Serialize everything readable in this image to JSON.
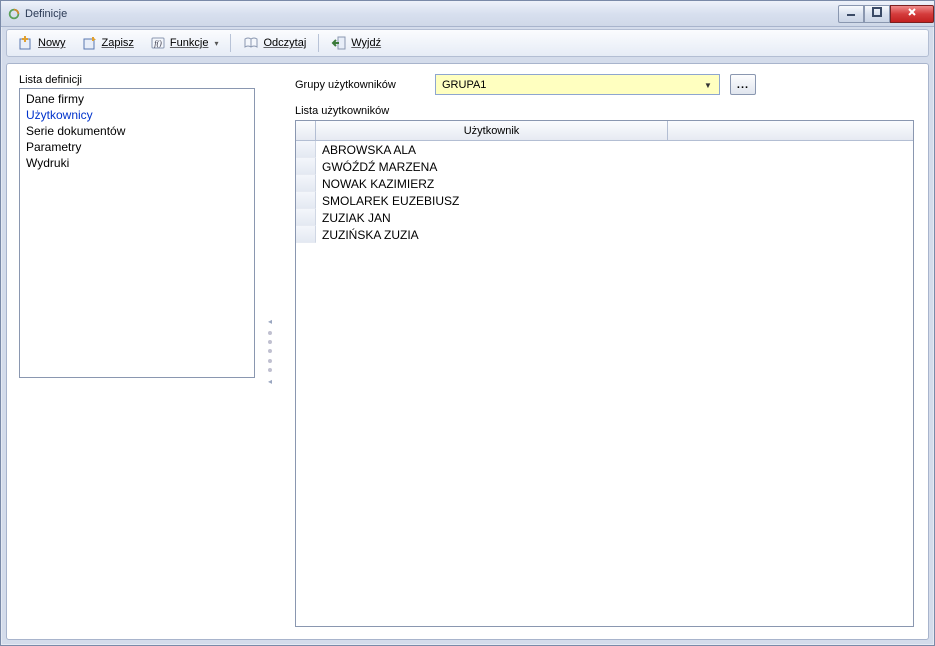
{
  "title": "Definicje",
  "toolbar": {
    "new": "Nowy",
    "save": "Zapisz",
    "functions": "Funkcje",
    "read": "Odczytaj",
    "exit": "Wyjdź"
  },
  "leftPane": {
    "label": "Lista definicji",
    "items": [
      {
        "name": "Dane firmy",
        "selected": false
      },
      {
        "name": "Użytkownicy",
        "selected": true
      },
      {
        "name": "Serie dokumentów",
        "selected": false
      },
      {
        "name": "Parametry",
        "selected": false
      },
      {
        "name": "Wydruki",
        "selected": false
      }
    ]
  },
  "rightPane": {
    "groupLabel": "Grupy użytkowników",
    "groupValue": "GRUPA1",
    "usersLabel": "Lista użytkowników",
    "columnHeader": "Użytkownik",
    "users": [
      "ABROWSKA ALA",
      "GWÓŹDŹ MARZENA",
      "NOWAK KAZIMIERZ",
      "SMOLAREK EUZEBIUSZ",
      "ZUZIAK JAN",
      "ZUZIŃSKA ZUZIA"
    ]
  }
}
